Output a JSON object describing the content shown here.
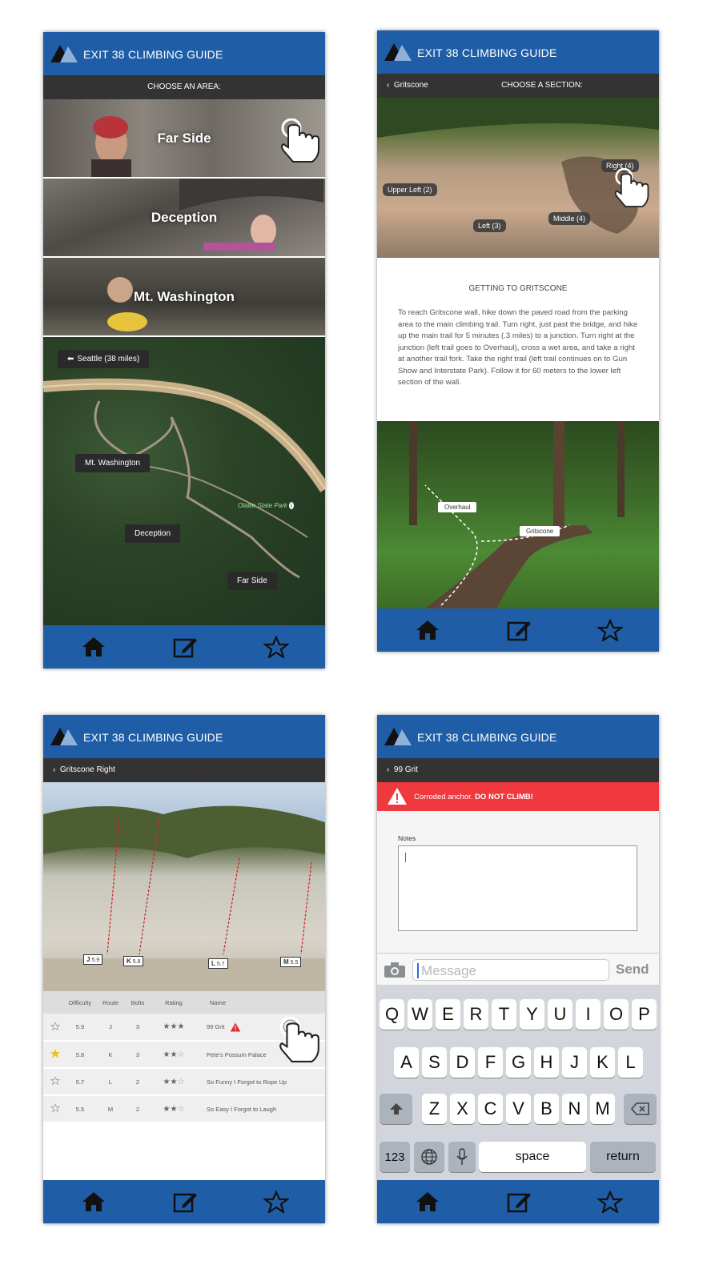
{
  "app": {
    "title": "EXIT 38 CLIMBING GUIDE",
    "brand_color": "#1f5ea6",
    "subbar_color": "#333333",
    "nav_icons": [
      "home-icon",
      "edit-icon",
      "star-icon"
    ]
  },
  "screen1": {
    "subtitle": "CHOOSE AN AREA:",
    "areas": [
      "Far Side",
      "Deception",
      "Mt. Washington"
    ],
    "map_labels": {
      "seattle": "Seattle (38 miles)",
      "mt_washington": "Mt. Washington",
      "park": "Olallie State Park",
      "deception": "Deception",
      "far_side": "Far Side"
    }
  },
  "screen2": {
    "back": "Gritscone",
    "subtitle": "CHOOSE A SECTION:",
    "sections": [
      "Upper Left (2)",
      "Left (3)",
      "Middle (4)",
      "Right (4)"
    ],
    "directions_title": "GETTING TO GRITSCONE",
    "directions_text": "To reach Gritscone wall, hike down the paved road from the parking area to the main climbing trail. Turn right, just past the bridge, and hike up the main trail for 5 minutes (.3 miles) to a junction. Turn right at the junction (left trail goes to Overhaul), cross a wet area, and take a right at another trail fork. Take the right trail (left trail continues on to Gun Show and Interstate Park). Follow it for 60 meters to the lower left section of the wall.",
    "trail_labels": [
      "Overhaul",
      "Gritscone"
    ]
  },
  "screen3": {
    "back": "Gritscone Right",
    "route_tags": [
      {
        "letter": "J",
        "grade": "5.9"
      },
      {
        "letter": "K",
        "grade": "5.8"
      },
      {
        "letter": "L",
        "grade": "5.7"
      },
      {
        "letter": "M",
        "grade": "5.5"
      }
    ],
    "columns": [
      "Difficulty",
      "Route",
      "Bolts",
      "Rating",
      "Name"
    ],
    "rows": [
      {
        "starred": false,
        "difficulty": "5.9",
        "route": "J",
        "bolts": "3",
        "rating": 3,
        "name": "99 Grit",
        "warning": true
      },
      {
        "starred": true,
        "difficulty": "5.8",
        "route": "K",
        "bolts": "3",
        "rating": 2,
        "name": "Pete's Possum Palace",
        "warning": false
      },
      {
        "starred": false,
        "difficulty": "5.7",
        "route": "L",
        "bolts": "2",
        "rating": 2,
        "name": "So Funny I Forgot to Rope Up",
        "warning": false
      },
      {
        "starred": false,
        "difficulty": "5.5",
        "route": "M",
        "bolts": "2",
        "rating": 2,
        "name": "So Easy I Forgot to Laugh",
        "warning": false
      }
    ]
  },
  "screen4": {
    "back": "99 Grit",
    "alert_prefix": "Corroded anchor.",
    "alert_strong": "DO NOT CLIMB!",
    "alert_color": "#f0393e",
    "notes_label": "Notes",
    "message_placeholder": "Message",
    "send_label": "Send",
    "keyboard": {
      "row1": [
        "Q",
        "W",
        "E",
        "R",
        "T",
        "Y",
        "U",
        "I",
        "O",
        "P"
      ],
      "row2": [
        "A",
        "S",
        "D",
        "F",
        "G",
        "H",
        "J",
        "K",
        "L"
      ],
      "row3": [
        "Z",
        "X",
        "C",
        "V",
        "B",
        "N",
        "M"
      ],
      "num_key": "123",
      "space_key": "space",
      "return_key": "return"
    }
  }
}
